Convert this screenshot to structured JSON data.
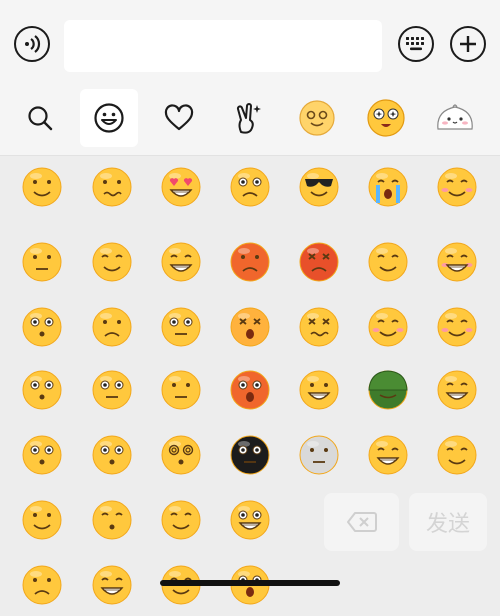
{
  "toolbar": {
    "voice_icon": "voice-input-icon",
    "input_value": "",
    "keyboard_icon": "keyboard-icon",
    "more_icon": "plus-icon"
  },
  "tabs": [
    {
      "name": "search",
      "icon": "search-icon",
      "active": false
    },
    {
      "name": "emoji",
      "icon": "smiley-icon",
      "active": true
    },
    {
      "name": "favorites",
      "icon": "heart-icon",
      "active": false
    },
    {
      "name": "gestures",
      "icon": "victory-hand-icon",
      "active": false
    },
    {
      "name": "sticker-pack-1",
      "icon": "heart-eyes-face-icon",
      "active": false
    },
    {
      "name": "sticker-pack-2",
      "icon": "starry-face-icon",
      "active": false
    },
    {
      "name": "sticker-pack-3",
      "icon": "white-blob-face-icon",
      "active": false
    }
  ],
  "emoji_rows": [
    [
      "smile",
      "awkward",
      "heart-eyes",
      "stare",
      "cool",
      "crying",
      "shy"
    ],
    [
      "silent",
      "sleepy",
      "cry-laugh",
      "angry",
      "furious",
      "wink",
      "grin"
    ],
    [
      "surprise",
      "sad",
      "worried",
      "scream",
      "sick",
      "giggle",
      "smirk"
    ],
    [
      "wide-eye",
      "thinking",
      "disdain",
      "shock",
      "laugh",
      "helmet",
      "rofl"
    ],
    [
      "question",
      "shush",
      "dizzy",
      "skull-black",
      "skeleton",
      "frying-pan",
      "facepalm"
    ],
    [
      "sweat",
      "pout",
      "pray",
      "clench"
    ],
    [
      "cry",
      "chuckle",
      "snicker",
      "astonished"
    ]
  ],
  "actions": {
    "delete_icon": "backspace-icon",
    "send_label": "发送"
  },
  "colors": {
    "face": "#FFC83D",
    "face_shade": "#F2A71B",
    "panel": "#EDEDED",
    "bar": "#F5F5F5",
    "send_text": "#D4D4D4"
  }
}
